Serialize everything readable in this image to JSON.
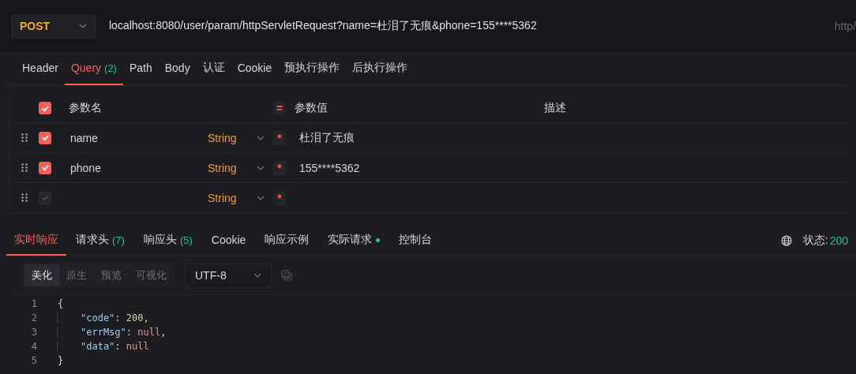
{
  "request": {
    "method": "POST",
    "url": "localhost:8080/user/param/httpServletRequest?name=杜泪了无痕&phone=155****5362",
    "url_hint": "http/"
  },
  "request_tabs": [
    {
      "label": "Header",
      "selected": false
    },
    {
      "label": "Query",
      "count": "(2)",
      "selected": true
    },
    {
      "label": "Path",
      "selected": false
    },
    {
      "label": "Body",
      "selected": false
    },
    {
      "label": "认证",
      "selected": false
    },
    {
      "label": "Cookie",
      "selected": false
    },
    {
      "label": "预执行操作",
      "selected": false
    },
    {
      "label": "后执行操作",
      "selected": false
    }
  ],
  "params_table": {
    "all_checked": true,
    "columns": [
      "参数名",
      "=",
      "参数值",
      "描述"
    ],
    "rows": [
      {
        "checked": true,
        "name": "name",
        "type": "String",
        "required": "*",
        "value": "杜泪了无痕"
      },
      {
        "checked": true,
        "name": "phone",
        "type": "String",
        "required": "*",
        "value": "155****5362"
      },
      {
        "checked": false,
        "name": "",
        "type": "String",
        "required": "*",
        "value": ""
      }
    ]
  },
  "response_tabs": [
    {
      "label": "实时响应",
      "dot": false,
      "selected": true
    },
    {
      "label": "请求头",
      "count": "(7)",
      "dot": false,
      "selected": false
    },
    {
      "label": "响应头",
      "count": "(5)",
      "dot": false,
      "selected": false
    },
    {
      "label": "Cookie",
      "dot": false,
      "selected": false
    },
    {
      "label": "响应示例",
      "dot": false,
      "selected": false
    },
    {
      "label": "实际请求",
      "dot": true,
      "selected": false
    },
    {
      "label": "控制台",
      "dot": false,
      "selected": false
    }
  ],
  "status": {
    "label": "状态:",
    "code": "200"
  },
  "view_modes": [
    {
      "label": "美化",
      "selected": true
    },
    {
      "label": "原生",
      "selected": false
    },
    {
      "label": "预览",
      "selected": false
    },
    {
      "label": "可视化",
      "selected": false
    }
  ],
  "encoding": "UTF-8",
  "code_lines": [
    {
      "number": "1",
      "indented": false,
      "tokens": [
        {
          "kind": "punct",
          "text": "{"
        }
      ]
    },
    {
      "number": "2",
      "indented": true,
      "tokens": [
        {
          "kind": "key",
          "text": "\"code\""
        },
        {
          "kind": "punct",
          "text": ": "
        },
        {
          "kind": "number",
          "text": "200"
        },
        {
          "kind": "punct",
          "text": ","
        }
      ]
    },
    {
      "number": "3",
      "indented": true,
      "tokens": [
        {
          "kind": "key",
          "text": "\"errMsg\""
        },
        {
          "kind": "punct",
          "text": ": "
        },
        {
          "kind": "null",
          "text": "null"
        },
        {
          "kind": "punct",
          "text": ","
        }
      ]
    },
    {
      "number": "4",
      "indented": true,
      "tokens": [
        {
          "kind": "key",
          "text": "\"data\""
        },
        {
          "kind": "punct",
          "text": ": "
        },
        {
          "kind": "null",
          "text": "null"
        }
      ]
    },
    {
      "number": "5",
      "indented": false,
      "tokens": [
        {
          "kind": "punct",
          "text": "}"
        }
      ]
    }
  ]
}
